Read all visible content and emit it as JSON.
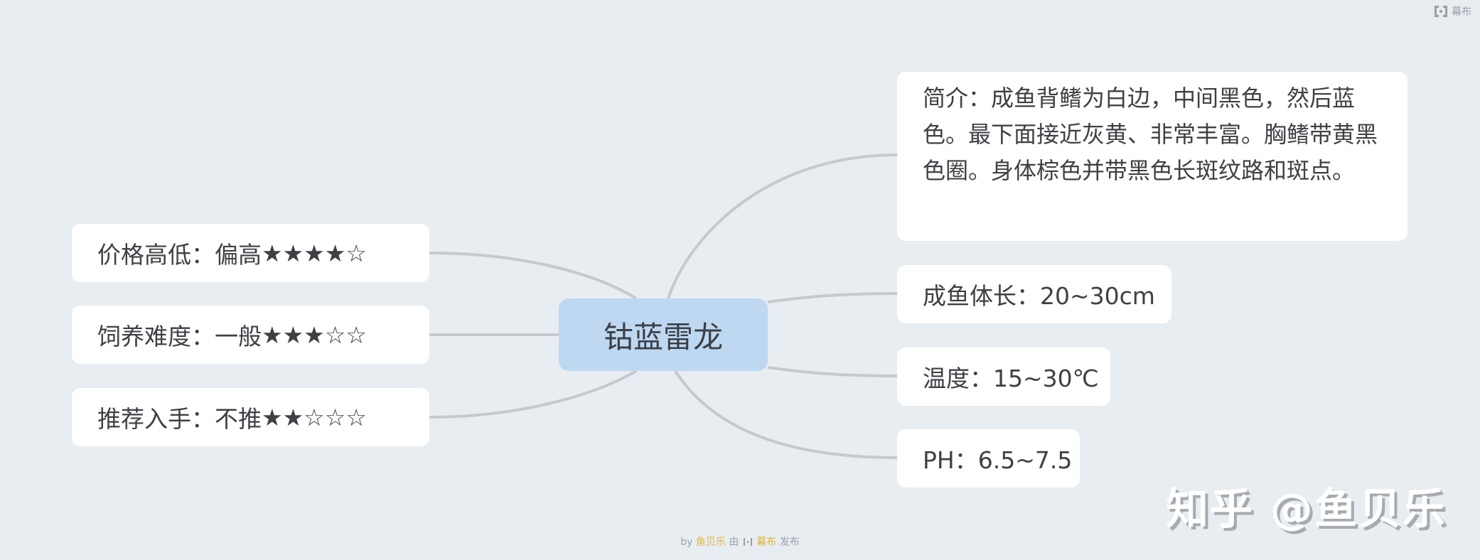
{
  "brand": {
    "name": "幕布",
    "icon": "mubu-logo-icon"
  },
  "mindmap": {
    "root": "钴蓝雷龙",
    "left": [
      {
        "label": "价格高低：偏高",
        "stars": "★★★★☆",
        "rating": 4,
        "max": 5
      },
      {
        "label": "饲养难度：一般",
        "stars": "★★★☆☆",
        "rating": 3,
        "max": 5
      },
      {
        "label": "推荐入手：不推",
        "stars": "★★☆☆☆",
        "rating": 2,
        "max": 5
      }
    ],
    "right": [
      {
        "label": "简介：成鱼背鳍为白边，中间黑色，然后蓝色。最下面接近灰黄、非常丰富。胸鳍带黄黑色圈。身体棕色并带黑色长斑纹路和斑点。"
      },
      {
        "label": "成鱼体长：20~30cm"
      },
      {
        "label": "温度：15~30℃"
      },
      {
        "label": "PH：6.5~7.5"
      }
    ]
  },
  "footer": {
    "by": "by",
    "author": "鱼贝乐",
    "via": "由",
    "platform": "幕布",
    "published": "发布"
  },
  "watermark": "知乎 @鱼贝乐",
  "colors": {
    "background": "#e8edf2",
    "root": "#bdd8f0",
    "node": "#ffffff",
    "link": "#c6c8cc",
    "accent": "#e2b43a"
  }
}
